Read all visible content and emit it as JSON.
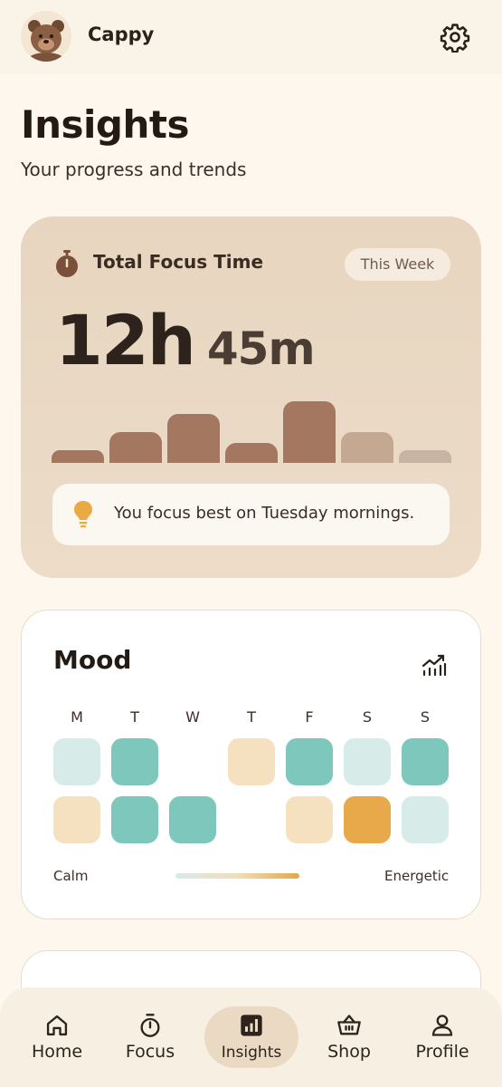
{
  "header": {
    "app_name": "Cappy",
    "avatar_icon": "bear-avatar",
    "settings_icon": "gear-icon"
  },
  "page": {
    "title": "Insights",
    "subtitle": "Your progress and trends"
  },
  "focus": {
    "label": "Total Focus Time",
    "period": "This Week",
    "hours": "12h",
    "minutes": "45m",
    "insight": "You focus best on Tuesday mornings.",
    "daily_relative": [
      0.2,
      0.5,
      0.8,
      0.33,
      1.0,
      0.5,
      0.2
    ],
    "bar_colors": [
      "#a47860",
      "#a47860",
      "#a47860",
      "#a47860",
      "#a47860",
      "#c4a892",
      "#c8b4a2"
    ]
  },
  "mood": {
    "title": "Mood",
    "days": [
      "M",
      "T",
      "W",
      "T",
      "F",
      "S",
      "S"
    ],
    "grid": [
      [
        "#d7ebe8",
        "#7dc7bd",
        null,
        "#f5e1bf",
        "#7dc7bd",
        "#d7ebe8",
        "#7dc7bd"
      ],
      [
        "#f5e1bf",
        "#7dc7bd",
        "#7dc7bd",
        null,
        "#f5e1bf",
        "#e8a94a",
        "#d7ebe8"
      ]
    ],
    "scale_left": "Calm",
    "scale_right": "Energetic"
  },
  "nav": {
    "items": [
      {
        "label": "Home",
        "icon": "home-icon"
      },
      {
        "label": "Focus",
        "icon": "stopwatch-icon"
      },
      {
        "label": "Insights",
        "icon": "chart-icon",
        "active": true
      },
      {
        "label": "Shop",
        "icon": "basket-icon"
      },
      {
        "label": "Profile",
        "icon": "person-icon"
      }
    ]
  }
}
